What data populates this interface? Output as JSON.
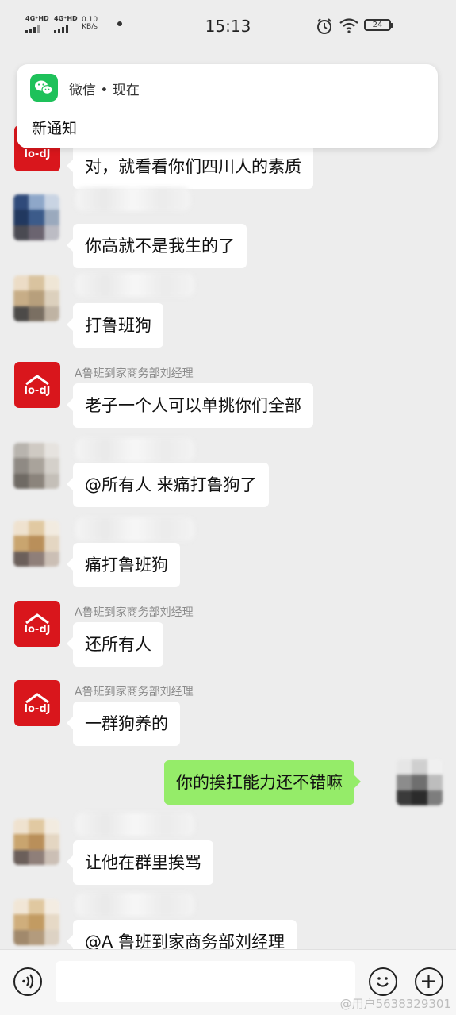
{
  "status_bar": {
    "network1": "4G⁺HD",
    "network2": "4G⁺HD",
    "speed_value": "0.10",
    "speed_unit": "KB/s",
    "time": "15:13",
    "battery": "24"
  },
  "notification": {
    "app": "微信 • 现在",
    "message": "新通知"
  },
  "chat": {
    "messages": [
      {
        "text": "对，就看看你们四川人的素质"
      },
      {
        "text": "你高就不是我生的了"
      },
      {
        "text": "打鲁班狗"
      },
      {
        "sender": "A鲁班到家商务部刘经理",
        "text": "老子一个人可以单挑你们全部"
      },
      {
        "text": "@所有人   来痛打鲁狗了"
      },
      {
        "text": "痛打鲁班狗"
      },
      {
        "sender": "A鲁班到家商务部刘经理",
        "text": "还所有人"
      },
      {
        "sender": "A鲁班到家商务部刘经理",
        "text": "一群狗养的"
      },
      {
        "text": "你的挨扛能力还不错嘛",
        "self": true
      },
      {
        "text": "让他在群里挨骂"
      },
      {
        "text": "@A 鲁班到家商务部刘经理"
      }
    ]
  },
  "logo_text": "lo-dJ",
  "icons": {
    "voice": "voice-icon",
    "emoji": "emoji-icon",
    "plus": "plus-icon",
    "wechat": "wechat-icon"
  },
  "watermark": "@用户5638329301",
  "colors": {
    "self_bubble": "#95ec69",
    "brand_red": "#d9161c",
    "wechat_green": "#1ec15a"
  }
}
